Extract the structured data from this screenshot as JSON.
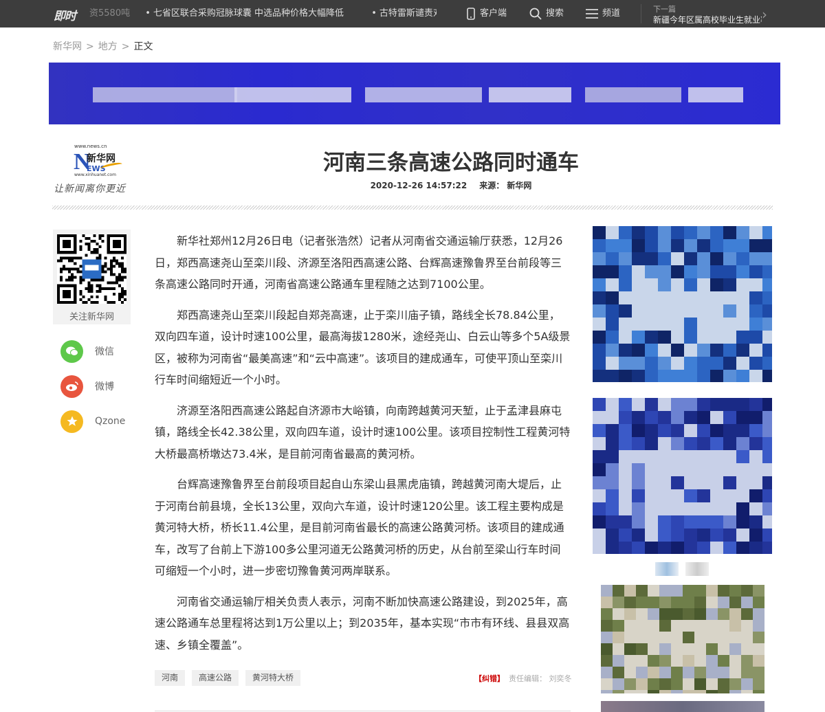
{
  "topbar": {
    "logo": "即时",
    "ticker": [
      "资5580吨",
      "七省区联合采购冠脉球囊 中选品种价格大幅降低",
      "古特雷斯谴责对联合国驻"
    ],
    "client": "客户端",
    "search": "搜索",
    "channel": "频道",
    "next_label": "下一篇",
    "next_title": "新疆今年区属高校毕业生就业率..."
  },
  "breadcrumb": {
    "home": "新华网",
    "section": "地方",
    "sep": ">",
    "current": "正文"
  },
  "logo": {
    "url_top": "www.news.cn",
    "letter": "N",
    "cn": "新华网",
    "ews": "EWS",
    "url_bottom": "www.xinhuanet.com",
    "slogan": "让新闻离你更近"
  },
  "article": {
    "title": "河南三条高速公路同时通车",
    "datetime": "2020-12-26 14:57:22",
    "source": "来源： 新华网",
    "paragraphs": [
      "新华社郑州12月26日电（记者张浩然）记者从河南省交通运输厅获悉，12月26日，郑西高速尧山至栾川段、济源至洛阳西高速公路、台辉高速豫鲁界至台前段等三条高速公路同时开通，河南省高速公路通车里程随之达到7100公里。",
      "郑西高速尧山至栾川段起自郑尧高速，止于栾川庙子镇，路线全长78.84公里，双向四车道，设计时速100公里，最高海拔1280米，途经尧山、白云山等多个5A级景区，被称为河南省“最美高速”和“云中高速”。该项目的建成通车，可使平顶山至栾川行车时间缩短近一个小时。",
      "济源至洛阳西高速公路起自济源市大峪镇，向南跨越黄河天堑，止于孟津县麻屯镇，路线全长42.38公里，双向四车道，设计时速100公里。该项目控制性工程黄河特大桥最高桥墩达73.4米，是目前河南省最高的黄河桥。",
      "台辉高速豫鲁界至台前段项目起自山东梁山县黑虎庙镇，跨越黄河南大堤后，止于河南台前县境，全长13公里，双向六车道，设计时速120公里。该工程主要构成是黄河特大桥，桥长11.4公里，是目前河南省最长的高速公路黄河桥。该项目的建成通车，改写了台前上下游100多公里河道无公路黄河桥的历史，从台前至梁山行车时间可缩短一个小时，进一步密切豫鲁黄河两岸联系。",
      "河南省交通运输厅相关负责人表示，河南不断加快高速公路建设，到2025年，高速公路通车总里程将达到1万公里以上；到2035年，基本实现“市市有环线、县县双高速、乡镇全覆盖”。"
    ],
    "tags": [
      "河南",
      "高速公路",
      "黄河特大桥"
    ],
    "correction": "【纠错】",
    "editor": "责任编辑： 刘奕冬"
  },
  "sidebar": {
    "qr_caption": "关注新华网",
    "share": [
      {
        "label": "微信",
        "icon": "wechat-icon",
        "color": "#5ec84a"
      },
      {
        "label": "微博",
        "icon": "weibo-icon",
        "color": "#e8553e"
      },
      {
        "label": "Qzone",
        "icon": "qzone-icon",
        "color": "#f5b921"
      }
    ]
  }
}
